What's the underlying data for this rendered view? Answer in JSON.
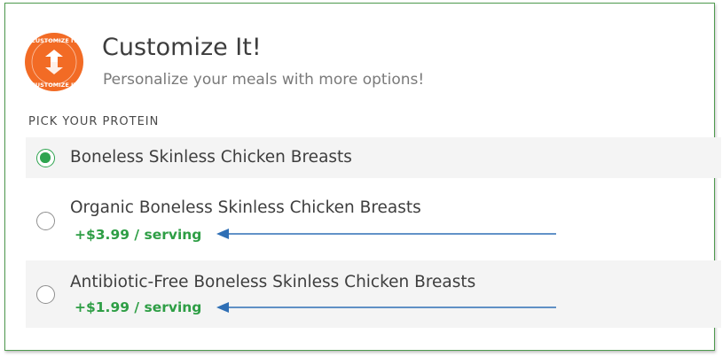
{
  "header": {
    "title": "Customize It!",
    "subtitle": "Personalize your meals with more options!",
    "logo_icon": "customize-it-badge",
    "logo_text": "CUSTOMIZE IT"
  },
  "section_label": "PICK YOUR PROTEIN",
  "options": [
    {
      "label": "Boneless Skinless Chicken Breasts",
      "price": "",
      "selected": true
    },
    {
      "label": "Organic Boneless Skinless Chicken Breasts",
      "price": "+$3.99 / serving",
      "selected": false
    },
    {
      "label": "Antibiotic-Free Boneless Skinless Chicken Breasts",
      "price": "+$1.99 / serving",
      "selected": false
    }
  ],
  "colors": {
    "accent_orange": "#f26b25",
    "selected_green": "#2ea44f",
    "price_green": "#2e9e45",
    "frame_green": "#4e9a4e",
    "arrow_blue": "#2f6fb5"
  }
}
